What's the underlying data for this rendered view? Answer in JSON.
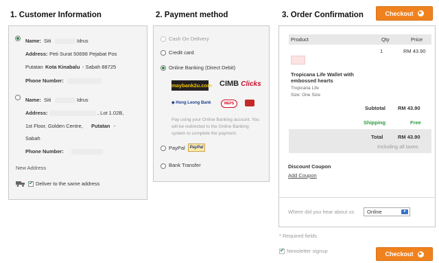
{
  "checkout_top": {
    "label": "Checkout"
  },
  "checkout_bottom": {
    "label": "Checkout"
  },
  "customer": {
    "title": "1. Customer Information",
    "addresses": [
      {
        "name_label": "Name:",
        "name_first": "Siti",
        "name_last": "Idrus",
        "address_label": "Address:",
        "address_line1": "Peti Surat 50698 Pejabat Pos",
        "address_line2_prefix": "Putatan",
        "address_line2_city": "Kota Kinabalu",
        "address_line2_rest": "- Sabah  88725",
        "phone_label": "Phone Number:"
      },
      {
        "name_label": "Name:",
        "name_first": "Siti",
        "name_last": "Idrus",
        "address_label": "Address:",
        "address_line1_tail": ", Lot 1.02B,",
        "address_line2": "1st Floor, Golden Centre,",
        "address_line2_city": "Putatan",
        "address_line3": "Sabah",
        "phone_label": "Phone Number:"
      }
    ],
    "new_address": "New Address",
    "deliver_same": "Deliver to the same address"
  },
  "payment": {
    "title": "2. Payment method",
    "options": {
      "cod": "Cash On Delivery",
      "card": "Credit card",
      "online": "Online Banking (Direct Debit)",
      "paypal": "PayPal",
      "transfer": "Bank Transfer"
    },
    "banks": {
      "maybank": "maybank2u.com",
      "cimb": "CIMB Clicks",
      "hongleong": "Hong Leong Bank",
      "meps": "MEPS",
      "fpx": "FPX"
    },
    "online_note_1": "Pay using your Online Banking account. You",
    "online_note_2": "will be redirected to the Online Banking",
    "online_note_3": "system to complete the payment.",
    "paypal_logo": "PayPal"
  },
  "order": {
    "title": "3. Order Confirmation",
    "headers": {
      "product": "Product",
      "qty": "Qty",
      "price": "Price"
    },
    "item": {
      "qty": "1",
      "price": "RM 43.90",
      "name_1": "Tropicana Life Wallet with",
      "name_2": "embossed hearts",
      "brand": "Tropicana Life",
      "size": "Size: One Size"
    },
    "subtotal_label": "Subtotal",
    "subtotal_value": "RM 43.90",
    "shipping_label": "Shipping",
    "shipping_value": "Free",
    "total_label": "Total",
    "total_value": "RM 43.90",
    "tax_note": "Including all taxes",
    "coupon_title": "Discount Coupon",
    "coupon_link": "Add Coupon",
    "hear_label": "Where did you hear about us",
    "hear_value": "Online"
  },
  "required_note": "* Required fields",
  "newsletter": "Newsletter signup",
  "colors": {
    "accent": "#f0821e",
    "green": "#2e9a3c",
    "panel_bg": "#f4f4f4"
  }
}
